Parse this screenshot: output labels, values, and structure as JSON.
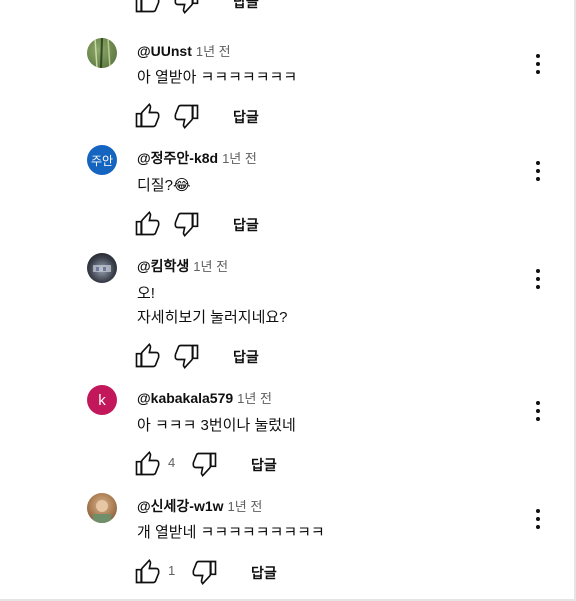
{
  "reply_label": "답글",
  "top_row": {
    "reply": "답글"
  },
  "comments": [
    {
      "author": "@UUnst",
      "time": "1년 전",
      "lines": [
        "아 열받아 ㅋㅋㅋㅋㅋㅋㅋ"
      ],
      "likes": "",
      "reply": "답글",
      "avatar_text": ""
    },
    {
      "author": "@정주안-k8d",
      "time": "1년 전",
      "lines": [
        "디질?😂"
      ],
      "likes": "",
      "reply": "답글",
      "avatar_text": "주안"
    },
    {
      "author": "@킴학생",
      "time": "1년 전",
      "lines": [
        "오!",
        "자세히보기 눌러지네요?"
      ],
      "likes": "",
      "reply": "답글",
      "avatar_text": ""
    },
    {
      "author": "@kabakala579",
      "time": "1년 전",
      "lines": [
        "아 ㅋㅋㅋ 3번이나 눌렀네"
      ],
      "likes": "4",
      "reply": "답글",
      "avatar_text": "k"
    },
    {
      "author": "@신세강-w1w",
      "time": "1년 전",
      "lines": [
        "개 열받네 ㅋㅋㅋㅋㅋㅋㅋㅋㅋ"
      ],
      "likes": "1",
      "reply": "답글",
      "avatar_text": ""
    }
  ],
  "colors": {
    "avatar_jooan": "#1565c0",
    "avatar_k": "#c2185b",
    "text": "#0f0f0f",
    "secondary": "#606060"
  }
}
